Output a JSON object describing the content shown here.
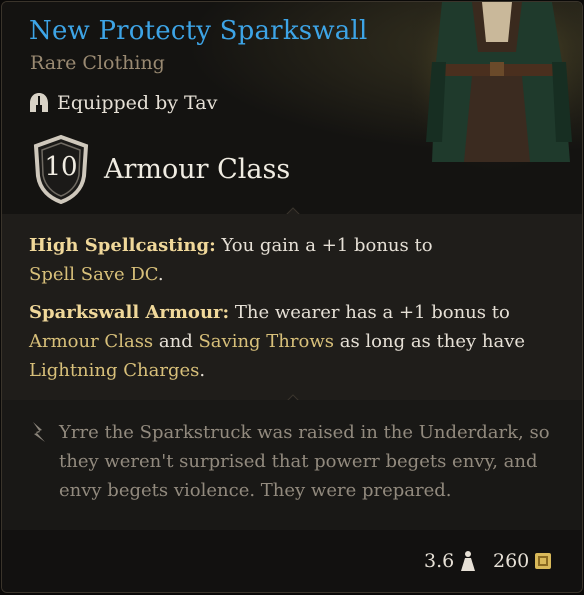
{
  "item": {
    "name": "New Protecty Sparkswall",
    "rarity": "Rare Clothing",
    "equipped_by": "Equipped by Tav",
    "armour_class_value": "10",
    "armour_class_label": "Armour Class"
  },
  "properties": [
    {
      "name": "High Spellcasting:",
      "text_1": " You gain a +1 bonus to",
      "link_1": "Spell Save DC",
      "text_2": "."
    },
    {
      "name": "Sparkswall Armour:",
      "text_1": " The wearer has a +1 bonus to",
      "link_1": "Armour Class",
      "text_2": " and ",
      "link_2": "Saving Throws",
      "text_3": " as long as they have",
      "link_3": "Lightning Charges",
      "text_4": "."
    }
  ],
  "lore": "Yrre the Sparkstruck was raised in the Underdark, so they weren't surprised that powerr begets envy, and envy begets violence. They were prepared.",
  "footer": {
    "weight": "3.6",
    "gold": "260"
  },
  "colors": {
    "title": "#3da4e6",
    "rarity": "#9a8a72",
    "keyword": "#f0d89a",
    "link": "#d8c07a",
    "lore": "#928a7e"
  },
  "icons": {
    "equipped": "helmet-icon",
    "armour_class": "shield-icon",
    "lore": "quill-icon",
    "weight": "weight-icon",
    "gold": "gold-coin-icon"
  }
}
